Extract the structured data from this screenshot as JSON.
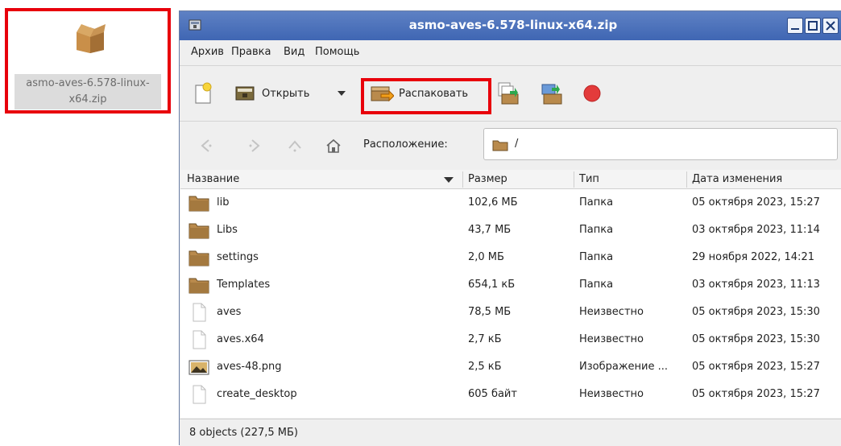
{
  "desktop": {
    "icon_label": "asmo-aves-6.578-linux-x64.zip"
  },
  "window": {
    "title": "asmo-aves-6.578-linux-x64.zip"
  },
  "menu": [
    "Архив",
    "Правка",
    "Вид",
    "Помощь"
  ],
  "toolbar": {
    "open_label": "Открыть",
    "extract_label": "Распаковать"
  },
  "location": {
    "label": "Расположение:",
    "path": "/"
  },
  "table": {
    "headers": [
      "Название",
      "Размер",
      "Тип",
      "Дата изменения"
    ],
    "rows": [
      {
        "name": "lib",
        "size": "102,6 МБ",
        "type": "Папка",
        "date": "05 октября 2023, 15:27",
        "icon": "folder-icon"
      },
      {
        "name": "Libs",
        "size": "43,7 МБ",
        "type": "Папка",
        "date": "03 октября 2023, 11:14",
        "icon": "folder-icon"
      },
      {
        "name": "settings",
        "size": "2,0 МБ",
        "type": "Папка",
        "date": "29 ноября 2022, 14:21",
        "icon": "folder-icon"
      },
      {
        "name": "Templates",
        "size": "654,1 кБ",
        "type": "Папка",
        "date": "03 октября 2023, 11:13",
        "icon": "folder-icon"
      },
      {
        "name": "aves",
        "size": "78,5 МБ",
        "type": "Неизвестно",
        "date": "05 октября 2023, 15:30",
        "icon": "file-icon"
      },
      {
        "name": "aves.x64",
        "size": "2,7 кБ",
        "type": "Неизвестно",
        "date": "05 октября 2023, 15:30",
        "icon": "file-icon"
      },
      {
        "name": "aves-48.png",
        "size": "2,5 кБ",
        "type": "Изображение ...",
        "date": "05 октября 2023, 15:27",
        "icon": "image-icon"
      },
      {
        "name": "create_desktop",
        "size": "605 байт",
        "type": "Неизвестно",
        "date": "05 октября 2023, 15:27",
        "icon": "file-icon"
      }
    ]
  },
  "status": "8 objects (227,5 МБ)",
  "colors": {
    "highlight": "#e8000b",
    "titlebar": "#4a6fb9",
    "folder": "#b98a4c"
  }
}
